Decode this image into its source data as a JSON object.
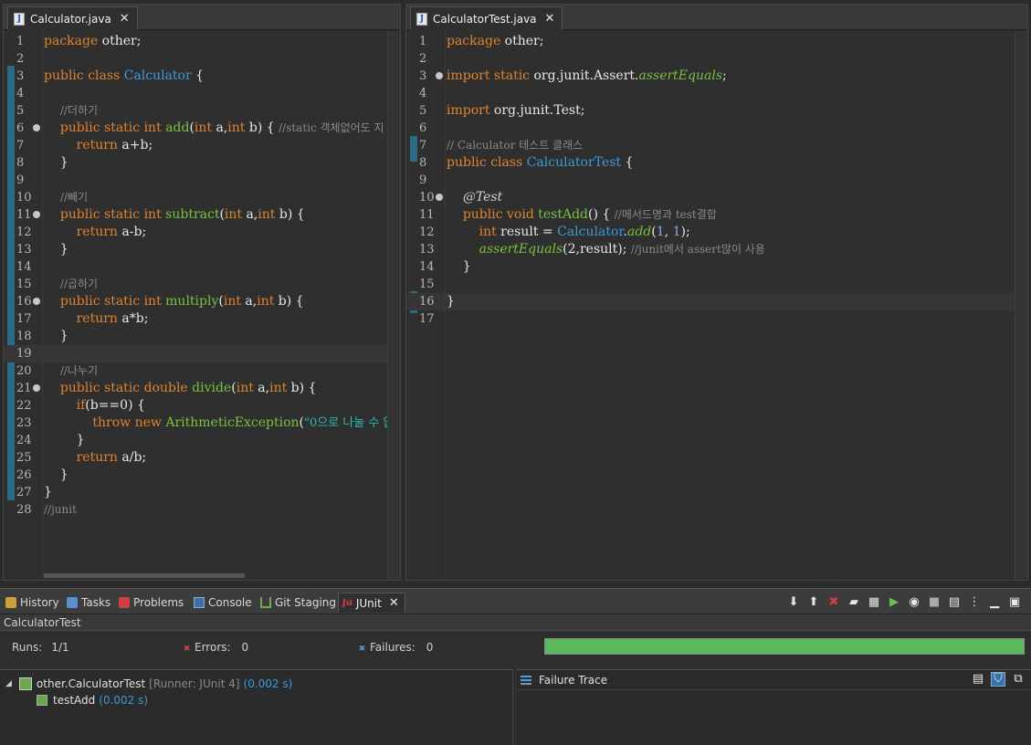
{
  "editor_left": {
    "tab_label": "Calculator.java",
    "lines": [
      {
        "n": "1",
        "html": "<span class=\"kw\">package</span> other;"
      },
      {
        "n": "2",
        "html": ""
      },
      {
        "n": "3",
        "html": "<span class=\"kw\">public</span> <span class=\"kw\">class</span> <span class=\"ty\">Calculator</span> {"
      },
      {
        "n": "4",
        "html": ""
      },
      {
        "n": "5",
        "html": "    <span class=\"cm\">//더하기</span>"
      },
      {
        "n": "6",
        "fold": true,
        "html": "    <span class=\"kw\">public</span> <span class=\"kw\">static</span> <span class=\"kw\">int</span> <span class=\"mt\">add</span>(<span class=\"kw\">int</span> a,<span class=\"kw\">int</span> b) { <span class=\"cm\">//static 객체없어도 지</span>"
      },
      {
        "n": "7",
        "html": "        <span class=\"kw\">return</span> a+b;"
      },
      {
        "n": "8",
        "html": "    }"
      },
      {
        "n": "9",
        "html": ""
      },
      {
        "n": "10",
        "html": "    <span class=\"cm\">//빼기</span>"
      },
      {
        "n": "11",
        "fold": true,
        "html": "    <span class=\"kw\">public</span> <span class=\"kw\">static</span> <span class=\"kw\">int</span> <span class=\"mt\">subtract</span>(<span class=\"kw\">int</span> a,<span class=\"kw\">int</span> b) {"
      },
      {
        "n": "12",
        "html": "        <span class=\"kw\">return</span> a-b;"
      },
      {
        "n": "13",
        "html": "    }"
      },
      {
        "n": "14",
        "html": ""
      },
      {
        "n": "15",
        "html": "    <span class=\"cm\">//곱하기</span>"
      },
      {
        "n": "16",
        "fold": true,
        "html": "    <span class=\"kw\">public</span> <span class=\"kw\">static</span> <span class=\"kw\">int</span> <span class=\"mt\">multiply</span>(<span class=\"kw\">int</span> a,<span class=\"kw\">int</span> b) {"
      },
      {
        "n": "17",
        "html": "        <span class=\"kw\">return</span> a*b;"
      },
      {
        "n": "18",
        "html": "    }"
      },
      {
        "n": "19",
        "current": true,
        "html": ""
      },
      {
        "n": "20",
        "html": "    <span class=\"cm\">//나누기</span>"
      },
      {
        "n": "21",
        "fold": true,
        "html": "    <span class=\"kw\">public</span> <span class=\"kw\">static</span> <span class=\"kw\">double</span> <span class=\"mt\">divide</span>(<span class=\"kw\">int</span> a,<span class=\"kw\">int</span> b) {"
      },
      {
        "n": "22",
        "html": "        <span class=\"kw\">if</span>(b==0) {"
      },
      {
        "n": "23",
        "html": "            <span class=\"kw\">throw</span> <span class=\"kw\">new</span> <span class=\"mt\">ArithmeticException</span>(<span class=\"str\">\"0으로 나눌 수 없</span>"
      },
      {
        "n": "24",
        "html": "        }"
      },
      {
        "n": "25",
        "html": "        <span class=\"kw\">return</span> a/b;"
      },
      {
        "n": "26",
        "html": "    }"
      },
      {
        "n": "27",
        "html": "}"
      },
      {
        "n": "28",
        "html": "<span class=\"cm\">//junit</span>"
      }
    ]
  },
  "editor_right": {
    "tab_label": "CalculatorTest.java",
    "lines": [
      {
        "n": "1",
        "html": "<span class=\"kw\">package</span> other;"
      },
      {
        "n": "2",
        "html": ""
      },
      {
        "n": "3",
        "fold": true,
        "html": "<span class=\"kw\">import</span> <span class=\"kw\">static</span> org.junit.Assert.<span class=\"mt it\">assertEquals</span>;"
      },
      {
        "n": "4",
        "html": ""
      },
      {
        "n": "5",
        "html": "<span class=\"kw\">import</span> org.junit.Test;"
      },
      {
        "n": "6",
        "html": ""
      },
      {
        "n": "7",
        "html": "<span class=\"cm\">// Calculator 테스트 클래스</span>"
      },
      {
        "n": "8",
        "html": "<span class=\"kw\">public</span> <span class=\"kw\">class</span> <span class=\"ty\">CalculatorTest</span> {"
      },
      {
        "n": "9",
        "html": ""
      },
      {
        "n": "10",
        "fold": true,
        "html": "    <span class=\"ann\">@Test</span>"
      },
      {
        "n": "11",
        "html": "    <span class=\"kw\">public</span> <span class=\"kw\">void</span> <span class=\"mt\">testAdd</span>() { <span class=\"cm\">//메서드명과 test결합</span>"
      },
      {
        "n": "12",
        "html": "        <span class=\"kw\">int</span> result = <span class=\"ty\">Calculator</span>.<span class=\"mt it\">add</span>(<span class=\"num\">1</span>, <span class=\"num\">1</span>);"
      },
      {
        "n": "13",
        "html": "        <span class=\"mt it\">assertEquals</span>(2,result); <span class=\"cm\">//junit에서 assert많이 사용</span>"
      },
      {
        "n": "14",
        "html": "    }"
      },
      {
        "n": "15",
        "html": ""
      },
      {
        "n": "16",
        "current": true,
        "html": "}"
      },
      {
        "n": "17",
        "html": ""
      }
    ]
  },
  "bottom": {
    "tabs": [
      {
        "label": "History"
      },
      {
        "label": "Tasks"
      },
      {
        "label": "Problems"
      },
      {
        "label": "Console"
      },
      {
        "label": "Git Staging"
      },
      {
        "label": "JUnit"
      }
    ],
    "breadcrumb": "CalculatorTest",
    "runs_label": "Runs:",
    "runs_value": "1/1",
    "errors_label": "Errors:",
    "errors_value": "0",
    "failures_label": "Failures:",
    "failures_value": "0",
    "progress": 1.0,
    "progress_color": "#5cb85c",
    "suite_name": "other.CalculatorTest",
    "suite_runner": "[Runner: JUnit 4]",
    "suite_time": "(0.002 s)",
    "test_name": "testAdd",
    "test_time": "(0.002 s)",
    "failure_trace_label": "Failure Trace"
  }
}
